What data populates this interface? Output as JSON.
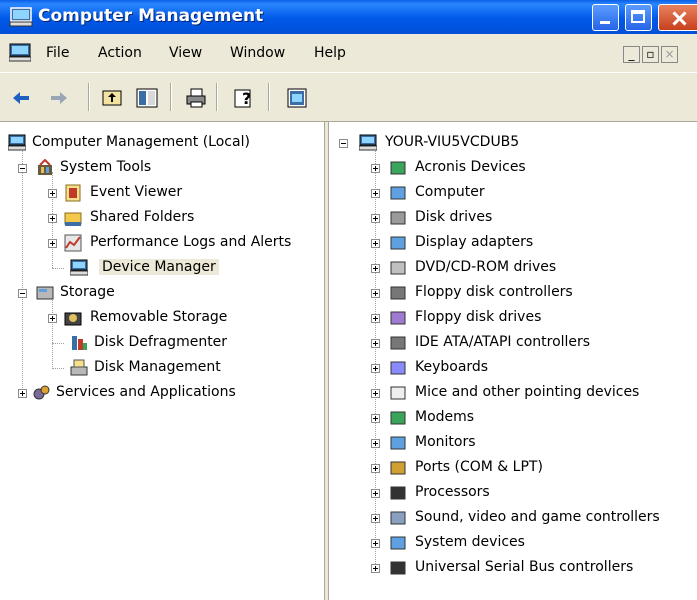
{
  "window": {
    "title": "Computer Management",
    "controls": [
      "minimize",
      "maximize",
      "close"
    ]
  },
  "menubar": {
    "items": [
      "File",
      "Action",
      "View",
      "Window",
      "Help"
    ]
  },
  "toolbar": {
    "buttons": [
      "back-arrow-icon",
      "forward-arrow-icon",
      "up-folder-icon",
      "show-hide-tree-icon",
      "print-icon",
      "help-icon",
      "properties-icon"
    ]
  },
  "left_tree": {
    "root": "Computer Management (Local)",
    "items": [
      {
        "label": "System Tools",
        "level": 1
      },
      {
        "label": "Event Viewer",
        "level": 2
      },
      {
        "label": "Shared Folders",
        "level": 2
      },
      {
        "label": "Performance Logs and Alerts",
        "level": 2
      },
      {
        "label": "Device Manager",
        "level": 2,
        "selected": true
      },
      {
        "label": "Storage",
        "level": 1
      },
      {
        "label": "Removable Storage",
        "level": 2
      },
      {
        "label": "Disk Defragmenter",
        "level": 2
      },
      {
        "label": "Disk Management",
        "level": 2
      },
      {
        "label": "Services and Applications",
        "level": 1
      }
    ]
  },
  "right_tree": {
    "root": "YOUR-VIU5VCDUB5",
    "items": [
      "Acronis Devices",
      "Computer",
      "Disk drives",
      "Display adapters",
      "DVD/CD-ROM drives",
      "Floppy disk controllers",
      "Floppy disk drives",
      "IDE ATA/ATAPI controllers",
      "Keyboards",
      "Mice and other pointing devices",
      "Modems",
      "Monitors",
      "Ports (COM & LPT)",
      "Processors",
      "Sound, video and game controllers",
      "System devices",
      "Universal Serial Bus controllers"
    ]
  }
}
